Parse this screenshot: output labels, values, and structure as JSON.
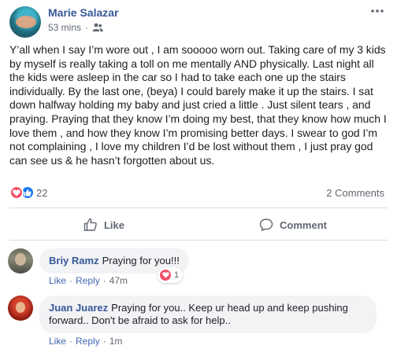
{
  "post": {
    "author": "Marie Salazar",
    "time": "53 mins",
    "separator": "·",
    "audience_icon": "friends-icon",
    "more_icon": "more-options-icon",
    "body": "Y’all when I say I’m wore out , I am sooooo worn out. Taking care of my 3 kids by myself is really taking a toll on me mentally AND physically. Last night all the kids were asleep in the car so I had to take each one up the stairs individually. By the last one, (beya) I could barely make it up the stairs. I sat down halfway holding my baby and just cried a little . Just silent tears , and praying. Praying that they know I’m doing my best, that they know how much I love them , and how they know I’m promising better days. I swear to god I’m not complaining , I love my children I’d be lost without them , I just pray god can see us & he hasn’t forgotten about us."
  },
  "reactions": {
    "icons": [
      "love-icon",
      "like-icon"
    ],
    "count": "22",
    "comments_label": "2 Comments",
    "colors": {
      "love": "#f25268",
      "like": "#1877f2"
    }
  },
  "actions": {
    "like_label": "Like",
    "comment_label": "Comment"
  },
  "comments": [
    {
      "name": "Briy Ramz",
      "text": "Praying for you!!!",
      "like_label": "Like",
      "reply_label": "Reply",
      "separator": "·",
      "time": "47m",
      "reaction_count": "1"
    },
    {
      "name": "Juan Juarez",
      "text": "Praying for you.. Keep ur head up and keep pushing forward.. Don't be afraid to ask for help..",
      "like_label": "Like",
      "reply_label": "Reply",
      "separator": "·",
      "time": "1m"
    }
  ],
  "theme": {
    "link_color": "#385898",
    "muted_text": "#606770",
    "bubble_bg": "#f2f3f5"
  }
}
